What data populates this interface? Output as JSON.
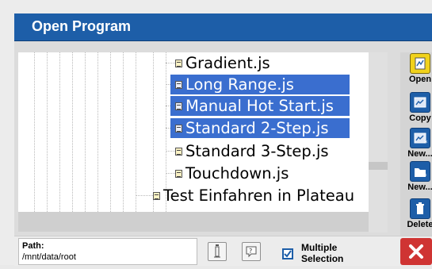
{
  "dialog": {
    "title": "Open Program",
    "accent_color": "#1d5ea8",
    "selection_color": "#3a6ecf"
  },
  "tree": {
    "items": [
      {
        "label": "Gradient.js",
        "selected": false,
        "icon": "file-icon"
      },
      {
        "label": "Long Range.js",
        "selected": true,
        "icon": "file-icon"
      },
      {
        "label": "Manual Hot Start.js",
        "selected": true,
        "icon": "file-icon"
      },
      {
        "label": "Standard 2-Step.js",
        "selected": true,
        "icon": "file-icon"
      },
      {
        "label": "Standard 3-Step.js",
        "selected": false,
        "icon": "file-icon"
      },
      {
        "label": "Touchdown.js",
        "selected": false,
        "icon": "file-icon"
      },
      {
        "label": "Test Einfahren in Plateau",
        "selected": false,
        "icon": "file-icon"
      }
    ]
  },
  "sidebar": {
    "open_label": "Open",
    "copy_label": "Copy",
    "new_label_1": "New...",
    "new_label_2": "New...",
    "delete_label": "Delete"
  },
  "footer": {
    "path_label": "Path:",
    "path_value": "/mnt/data/root",
    "info_icon": "info-icon",
    "help_icon": "help-icon",
    "multi_line1": "Multiple",
    "multi_line2": "Selection",
    "multi_checked": true,
    "close_icon": "close-icon",
    "close_color": "#cf3433"
  }
}
